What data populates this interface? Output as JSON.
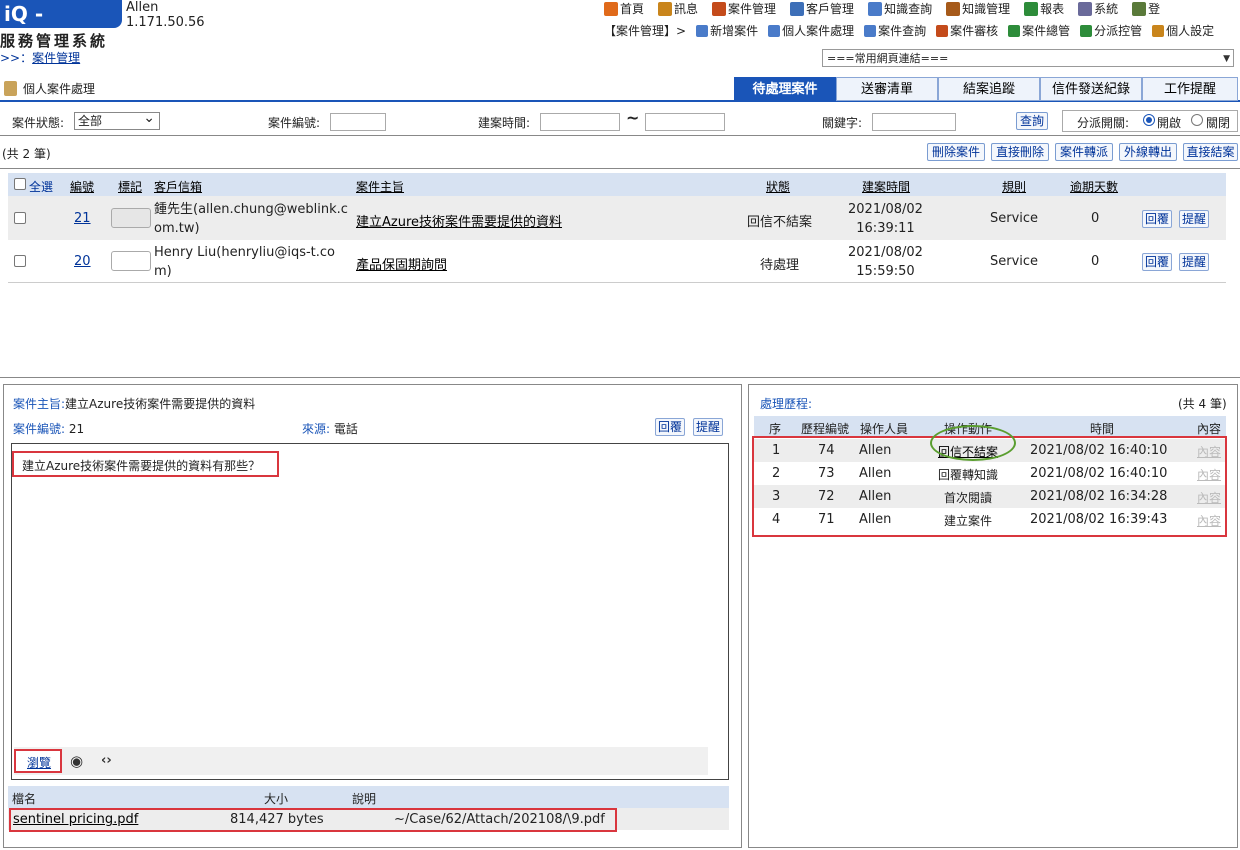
{
  "header": {
    "logo": "iQ - Support",
    "system_name": "服務管理系統",
    "user_name": "Allen",
    "user_ip": "1.171.50.56",
    "breadcrumb_prefix": ">>：",
    "breadcrumb_link": "案件管理"
  },
  "top_menu": [
    {
      "label": "首頁",
      "icon": "home-icon",
      "color": "#e06a1a"
    },
    {
      "label": "訊息",
      "icon": "mail-icon",
      "color": "#c9851c"
    },
    {
      "label": "案件管理",
      "icon": "folder-icon",
      "color": "#c44b1b"
    },
    {
      "label": "客戶管理",
      "icon": "customer-icon",
      "color": "#3d6fb8"
    },
    {
      "label": "知識查詢",
      "icon": "search-icon",
      "color": "#4a7bc9"
    },
    {
      "label": "知識管理",
      "icon": "book-icon",
      "color": "#a65a1a"
    },
    {
      "label": "報表",
      "icon": "report-icon",
      "color": "#2d8c3a"
    },
    {
      "label": "系統",
      "icon": "system-icon",
      "color": "#6a6a9a"
    },
    {
      "label": "登",
      "icon": "logout-icon",
      "color": "#5a7a3a"
    }
  ],
  "sub_menu": {
    "prefix": "【案件管理】>",
    "items": [
      {
        "label": "新增案件",
        "icon": "new-case-icon",
        "color": "#4a7bc9"
      },
      {
        "label": "個人案件處理",
        "icon": "personal-case-icon",
        "color": "#4a7bc9"
      },
      {
        "label": "案件查詢",
        "icon": "case-search-icon",
        "color": "#4a7bc9"
      },
      {
        "label": "案件審核",
        "icon": "case-review-icon",
        "color": "#c44b1b"
      },
      {
        "label": "案件總管",
        "icon": "case-master-icon",
        "color": "#2d8c3a"
      },
      {
        "label": "分派控管",
        "icon": "dispatch-icon",
        "color": "#2d8c3a"
      },
      {
        "label": "個人設定",
        "icon": "settings-icon",
        "color": "#c9851c"
      }
    ]
  },
  "quick_links": "===常用網頁連結===",
  "page_title": "個人案件處理",
  "tabs": [
    {
      "label": "待處理案件",
      "active": true
    },
    {
      "label": "送審清單",
      "active": false
    },
    {
      "label": "結案追蹤",
      "active": false
    },
    {
      "label": "信件發送紀錄",
      "active": false
    },
    {
      "label": "工作提醒",
      "active": false
    }
  ],
  "filters": {
    "status_label": "案件狀態:",
    "status_value": "全部",
    "case_no_label": "案件編號:",
    "created_label": "建案時間:",
    "range_sep": "~",
    "keyword_label": "關鍵字:",
    "query_button": "查詢",
    "dispatch_label": "分派開關:",
    "dispatch_on": "開啟",
    "dispatch_off": "關閉"
  },
  "list": {
    "count": "(共 2 筆)",
    "actions": [
      "刪除案件",
      "直接刪除",
      "案件轉派",
      "外線轉出",
      "直接結案"
    ],
    "headers": {
      "select_all": "全選",
      "no": "編號",
      "mark": "標記",
      "customer": "客戶信箱",
      "subject": "案件主旨",
      "status": "狀態",
      "created": "建案時間",
      "rule": "規則",
      "overdue": "逾期天數"
    },
    "rows": [
      {
        "no": "21",
        "customer_l1": "鍾先生(allen.chung@weblink.c",
        "customer_l2": "om.tw)",
        "subject": "建立Azure技術案件需要提供的資料",
        "status": "回信不結案",
        "date": "2021/08/02",
        "time": "16:39:11",
        "rule": "Service",
        "overdue": "0",
        "reply": "回覆",
        "remind": "提醒"
      },
      {
        "no": "20",
        "customer_l1": "Henry Liu(henryliu@iqs-t.co",
        "customer_l2": "m)",
        "subject": "產品保固期詢問",
        "status": "待處理",
        "date": "2021/08/02",
        "time": "15:59:50",
        "rule": "Service",
        "overdue": "0",
        "reply": "回覆",
        "remind": "提醒"
      }
    ]
  },
  "detail": {
    "subject_label": "案件主旨:",
    "subject_value": "建立Azure技術案件需要提供的資料",
    "case_no_label": "案件編號:",
    "case_no_value": "21",
    "source_label": "來源:",
    "source_value": "電話",
    "reply_button": "回覆",
    "remind_button": "提醒",
    "content": "建立Azure技術案件需要提供的資料有那些？",
    "browse_button": "瀏覽",
    "attach_headers": {
      "name": "檔名",
      "size": "大小",
      "desc": "說明"
    },
    "attachment": {
      "name": "sentinel pricing.pdf",
      "size": "814,427 bytes",
      "path": "~/Case/62/Attach/202108/\\9.pdf"
    }
  },
  "history": {
    "title": "處理歷程:",
    "count": "(共 4 筆)",
    "headers": {
      "seq": "序",
      "hist_no": "歷程編號",
      "operator": "操作人員",
      "action": "操作動作",
      "time": "時間",
      "content": "內容"
    },
    "rows": [
      {
        "seq": "1",
        "hist_no": "74",
        "operator": "Allen",
        "action": "回信不結案",
        "time": "2021/08/02 16:40:10",
        "content": "內容"
      },
      {
        "seq": "2",
        "hist_no": "73",
        "operator": "Allen",
        "action": "回覆轉知識",
        "time": "2021/08/02 16:40:10",
        "content": "內容"
      },
      {
        "seq": "3",
        "hist_no": "72",
        "operator": "Allen",
        "action": "首次閱讀",
        "time": "2021/08/02 16:34:28",
        "content": "內容"
      },
      {
        "seq": "4",
        "hist_no": "71",
        "operator": "Allen",
        "action": "建立案件",
        "time": "2021/08/02 16:39:43",
        "content": "內容"
      }
    ]
  }
}
